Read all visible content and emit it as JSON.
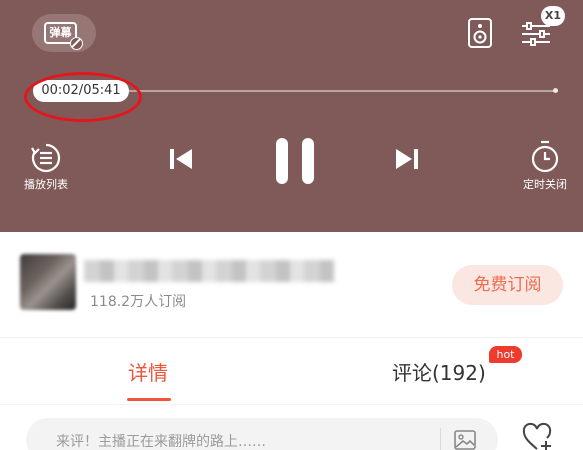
{
  "player": {
    "background": "#7f5a58",
    "danmu_label": "弹幕",
    "speed_label": "X1",
    "time_display": "00:02/05:41",
    "progress_fraction": 0.006,
    "playlist_label": "播放列表",
    "timer_label": "定时关闭",
    "icons": [
      "danmu-off-icon",
      "speaker-icon",
      "settings-sliders-icon",
      "playlist-icon",
      "previous-icon",
      "pause-icon",
      "next-icon",
      "timer-icon"
    ],
    "annotation_color": "#e4161b"
  },
  "channel": {
    "subscribers": "118.2万人订阅",
    "subscribe_label": "免费订阅"
  },
  "tabs": {
    "details_label": "详情",
    "comments_label": "评论(192)",
    "hot_badge": "hot",
    "active_color": "#f0543a"
  },
  "comment": {
    "placeholder": "来评！主播正在来翻牌的路上……"
  }
}
